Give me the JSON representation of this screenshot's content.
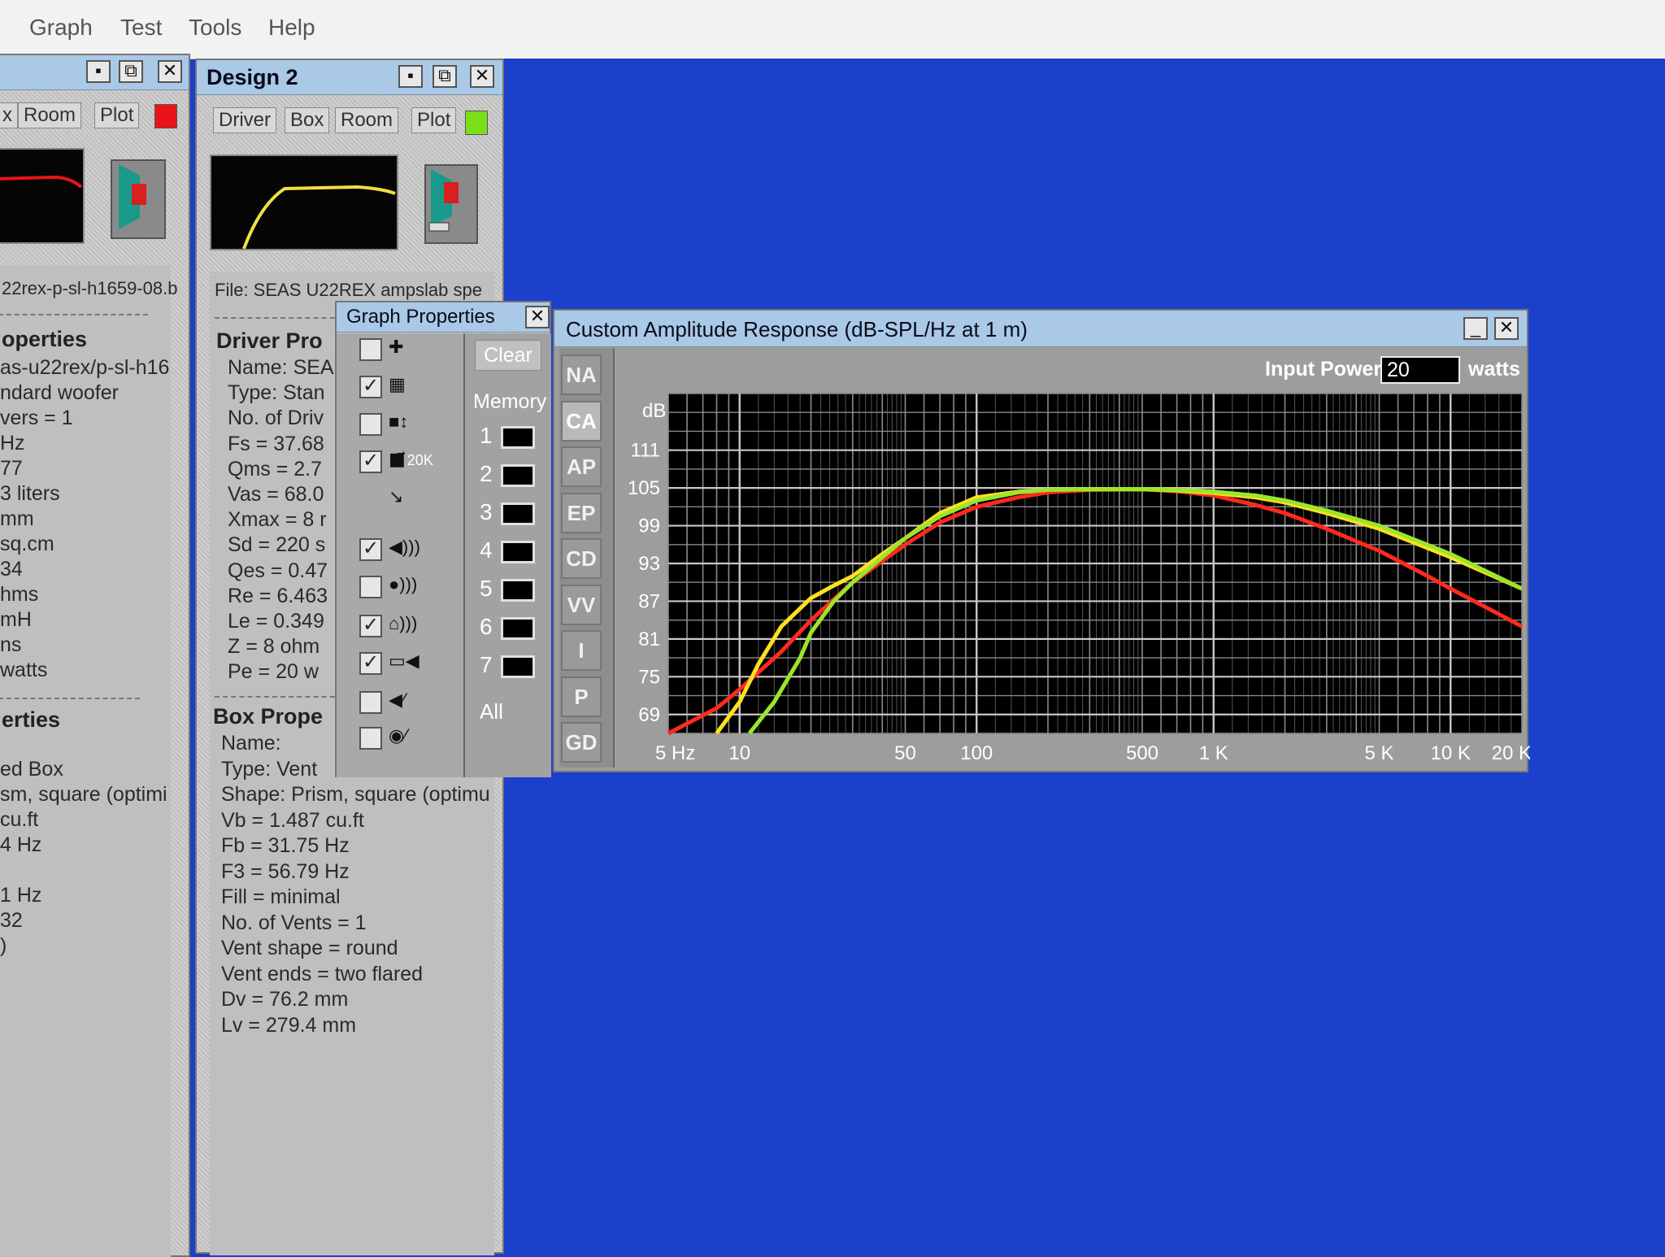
{
  "menu": [
    "Graph",
    "Test",
    "Tools",
    "Help"
  ],
  "design1": {
    "tabs": [
      "x",
      "Room",
      "Plot"
    ],
    "plot_color": "#e8141a",
    "file": "22rex-p-sl-h1659-08.b",
    "driver_heading": "operties",
    "driver_lines": [
      "as-u22rex/p-sl-h16",
      "ndard woofer",
      "vers = 1",
      "Hz",
      "77",
      "3 liters",
      " mm",
      "sq.cm",
      "34",
      "hms",
      "mH",
      "ns",
      "watts"
    ],
    "box_heading": "erties",
    "box_lines": [
      "ed Box",
      "sm, square (optimi",
      "cu.ft",
      "4 Hz",
      "",
      "1 Hz",
      "32",
      ")"
    ]
  },
  "design2": {
    "title": "Design 2",
    "tabs": [
      "Driver",
      "Box",
      "Room",
      "Plot"
    ],
    "plot_color": "#7adf1a",
    "file": "File: SEAS U22REX ampslab spe",
    "driver_heading": "Driver Pro",
    "driver_lines": [
      "Name: SEA",
      "Type: Stan",
      "No. of Driv",
      "Fs = 37.68",
      "Qms = 2.7",
      "Vas = 68.0",
      "Xmax = 8 r",
      "Sd = 220 s",
      "Qes = 0.47",
      "Re = 6.463",
      "Le = 0.349",
      "Z = 8 ohm",
      "Pe = 20 w"
    ],
    "box_heading": "Box Prope",
    "box_lines": [
      "Name:",
      "Type: Vent",
      "Shape: Prism, square (optimu",
      "Vb = 1.487 cu.ft",
      "Fb = 31.75 Hz",
      "F3 = 56.79 Hz",
      "Fill = minimal",
      "No. of Vents = 1",
      "Vent shape = round",
      "Vent ends = two flared",
      "Dv = 76.2 mm",
      "Lv = 279.4 mm"
    ]
  },
  "graph_properties": {
    "title": "Graph Properties",
    "clear_label": "Clear",
    "memory_label": "Memory",
    "memory_slots": [
      "1",
      "2",
      "3",
      "4",
      "5",
      "6",
      "7"
    ],
    "all_label": "All",
    "checkboxes": [
      false,
      true,
      false,
      true,
      false,
      true,
      false,
      true,
      true,
      false,
      false
    ],
    "icon_20k": "20K",
    "icons": [
      "plus-icon",
      "grid-icon",
      "auto-scale-icon",
      "range-20k-icon",
      "export-icon",
      "driver-speaker-icon",
      "box-speaker-icon",
      "room-speaker-icon",
      "amplifier-speaker-icon",
      "speaker-graph-icon",
      "driver-graph-icon"
    ]
  },
  "amplitude_window": {
    "title": "Custom Amplitude Response (dB-SPL/Hz at 1 m)",
    "input_power_label": "Input Power:",
    "input_power_value": "20",
    "input_power_unit": "watts",
    "side_tabs": [
      "NA",
      "CA",
      "AP",
      "EP",
      "CD",
      "VV",
      "I",
      "P",
      "GD"
    ],
    "active_tab": "CA"
  },
  "chart_data": {
    "type": "line",
    "ylabel": "dB",
    "xscale": "log",
    "xlim": [
      5,
      20000
    ],
    "ylim": [
      66,
      120
    ],
    "y_ticks": [
      111,
      105,
      99,
      93,
      87,
      81,
      75,
      69
    ],
    "x_ticks": [
      {
        "label": "5 Hz",
        "value": 5
      },
      {
        "label": "10",
        "value": 10
      },
      {
        "label": "50",
        "value": 50
      },
      {
        "label": "100",
        "value": 100
      },
      {
        "label": "500",
        "value": 500
      },
      {
        "label": "1 K",
        "value": 1000
      },
      {
        "label": "5 K",
        "value": 5000
      },
      {
        "label": "10 K",
        "value": 10000
      },
      {
        "label": "20 K",
        "value": 20000
      }
    ],
    "grid": true,
    "series": [
      {
        "color": "#ff2a1e",
        "points": [
          [
            5,
            66
          ],
          [
            8,
            70
          ],
          [
            10,
            73
          ],
          [
            15,
            79
          ],
          [
            20,
            84
          ],
          [
            30,
            90
          ],
          [
            50,
            96
          ],
          [
            70,
            99.5
          ],
          [
            100,
            102
          ],
          [
            150,
            103.5
          ],
          [
            200,
            104.3
          ],
          [
            300,
            104.7
          ],
          [
            500,
            104.8
          ],
          [
            700,
            104.5
          ],
          [
            1000,
            103.8
          ],
          [
            1500,
            102.3
          ],
          [
            2000,
            101
          ],
          [
            3000,
            98.5
          ],
          [
            5000,
            95
          ],
          [
            8000,
            91
          ],
          [
            10000,
            89
          ],
          [
            15000,
            85.5
          ],
          [
            20000,
            83
          ]
        ]
      },
      {
        "color": "#ffe020",
        "points": [
          [
            8,
            66
          ],
          [
            10,
            71
          ],
          [
            12,
            77
          ],
          [
            15,
            83
          ],
          [
            20,
            87.5
          ],
          [
            25,
            89.5
          ],
          [
            30,
            91
          ],
          [
            40,
            94.5
          ],
          [
            50,
            97
          ],
          [
            70,
            101
          ],
          [
            100,
            103.5
          ],
          [
            150,
            104.4
          ],
          [
            200,
            104.7
          ],
          [
            300,
            104.8
          ],
          [
            500,
            104.8
          ],
          [
            700,
            104.6
          ],
          [
            1000,
            104.2
          ],
          [
            1500,
            103.5
          ],
          [
            2000,
            102.7
          ],
          [
            3000,
            101
          ],
          [
            5000,
            98.5
          ],
          [
            10000,
            94
          ],
          [
            20000,
            89
          ]
        ]
      },
      {
        "color": "#9ae62a",
        "points": [
          [
            11,
            66
          ],
          [
            14,
            71
          ],
          [
            18,
            78
          ],
          [
            20,
            82
          ],
          [
            25,
            87
          ],
          [
            30,
            90
          ],
          [
            40,
            94
          ],
          [
            50,
            97
          ],
          [
            70,
            100.5
          ],
          [
            100,
            103
          ],
          [
            150,
            104.3
          ],
          [
            200,
            104.7
          ],
          [
            300,
            104.8
          ],
          [
            500,
            104.8
          ],
          [
            700,
            104.7
          ],
          [
            1000,
            104.4
          ],
          [
            1500,
            103.8
          ],
          [
            2000,
            103
          ],
          [
            3000,
            101.4
          ],
          [
            5000,
            99
          ],
          [
            10000,
            94.5
          ],
          [
            20000,
            89
          ]
        ]
      }
    ]
  }
}
